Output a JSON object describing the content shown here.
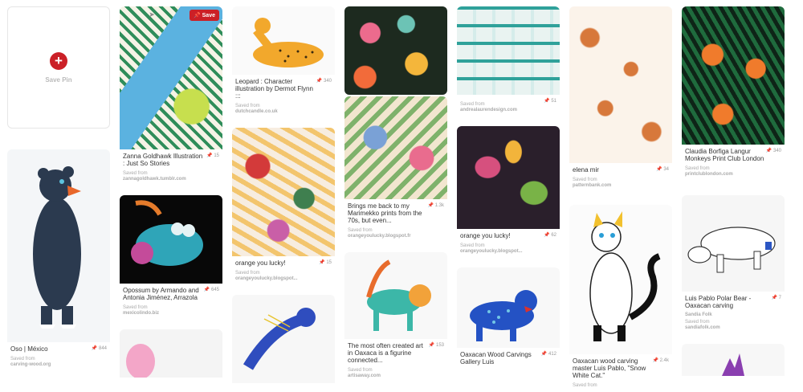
{
  "save_pin": {
    "label": "Save Pin",
    "icon": "plus-icon"
  },
  "buttons": {
    "save": "Save"
  },
  "saved_from_label": "Saved from",
  "pins": {
    "zanna": {
      "desc": "Zanna Goldhawk Illustration : Just So Stories",
      "count": "15",
      "source": "zannagoldhawk.tumblr.com"
    },
    "leopard": {
      "desc": "Leopard : Character illustration by Dermot Flynn :::",
      "count": "340",
      "source": "dutchcandle.co.uk"
    },
    "marimekko": {
      "desc": "Brings me back to my Marimekko prints from the 70s, but even...",
      "count": "1.3k",
      "source": "orangeyoulucky.blogspot.fr"
    },
    "teal": {
      "desc": "",
      "count": "51",
      "source": "andrealaurendesign.com"
    },
    "elena": {
      "desc": "elena mir",
      "count": "34",
      "source": "patternbank.com"
    },
    "claudia": {
      "desc": "Claudia Borfiga Langur Monkeys Print Club London",
      "count": "340",
      "source": "printclublondon.com"
    },
    "bear": {
      "desc": "Oso | México",
      "count": "844",
      "source": "carving-wood.org"
    },
    "opossum": {
      "desc": "Opossum by Armando and Antonia Jiménez, Arrazola",
      "count": "645",
      "source": "mexicolindo.biz"
    },
    "horses": {
      "desc": "orange you lucky!",
      "count": "15",
      "source": "orangeyoulucky.blogspot..."
    },
    "alebrije": {
      "desc": "The most often created art in Oaxaca is a figurine connected...",
      "count": "153",
      "source": "artisaway.com"
    },
    "leaves": {
      "desc": "orange you lucky!",
      "count": "62",
      "source": "orangeyoulucky.blogspot..."
    },
    "jaguar": {
      "desc": "Oaxacan Wood Carvings Gallery Luis",
      "count": "412",
      "source": ""
    },
    "whitecat": {
      "desc": "Oaxacan wood carving master Luis Pablo, \"Snow White Cat.\"",
      "count": "2.4k",
      "source": ""
    },
    "polar": {
      "desc": "Luis Pablo Polar Bear - Oaxacan carving",
      "count": "7",
      "source": "sandiafolk.com",
      "extra": "Sandia Folk"
    }
  },
  "colors": {
    "brand_red": "#cb2027"
  }
}
